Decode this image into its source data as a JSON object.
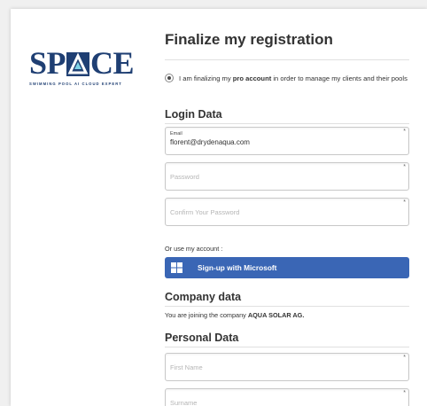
{
  "logo": {
    "word_left": "SP",
    "word_right": "CE",
    "tagline": "SWIMMING POOL AI CLOUD EXPERT"
  },
  "form": {
    "title": "Finalize my registration",
    "account_choice": {
      "prefix": "I am finalizing my ",
      "emphasis": "pro account",
      "suffix": " in order to manage my clients and their pools",
      "selected": true
    },
    "login_section": "Login Data",
    "email": {
      "label": "Email",
      "value": "florent@drydenaqua.com",
      "required_mark": "*"
    },
    "password": {
      "placeholder": "Password",
      "required_mark": "*"
    },
    "confirm_password": {
      "placeholder": "Confirm Your Password",
      "required_mark": "*"
    },
    "or_use_account": "Or use my account :",
    "microsoft_button": "Sign-up with Microsoft",
    "company_section": "Company data",
    "company_text_prefix": "You are joining the company ",
    "company_name": "AQUA SOLAR AG.",
    "personal_section": "Personal Data",
    "first_name": {
      "placeholder": "First Name",
      "required_mark": "*"
    },
    "surname": {
      "placeholder": "Surname",
      "required_mark": "*"
    }
  },
  "colors": {
    "brand": "#1f3f73",
    "button": "#3a66b5",
    "background": "#f0f0f0"
  },
  "icons": [
    "radio-selected-icon",
    "windows-logo-icon",
    "logo-a-triangle-icon"
  ]
}
